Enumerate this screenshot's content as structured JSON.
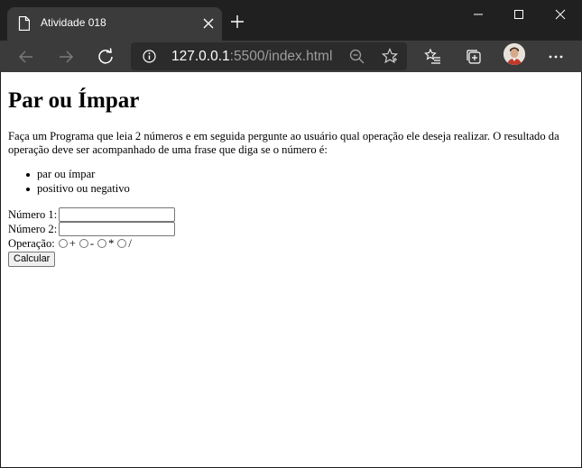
{
  "browser": {
    "tab": {
      "title": "Atividade 018"
    },
    "address": {
      "host": "127.0.0.1",
      "path": ":5500/index.html"
    }
  },
  "page": {
    "heading": "Par ou Ímpar",
    "description": "Faça um Programa que leia 2 números e em seguida pergunte ao usuário qual operação ele deseja realizar. O resultado da operação deve ser acompanhado de uma frase que diga se o número é:",
    "list": [
      "par ou ímpar",
      "positivo ou negativo"
    ],
    "form": {
      "number1_label": "Número 1:",
      "number1_value": "",
      "number2_label": "Número 2:",
      "number2_value": "",
      "operation_label": "Operação:",
      "operations": [
        "+",
        "-",
        "*",
        "/"
      ],
      "submit_label": "Calcular"
    }
  }
}
